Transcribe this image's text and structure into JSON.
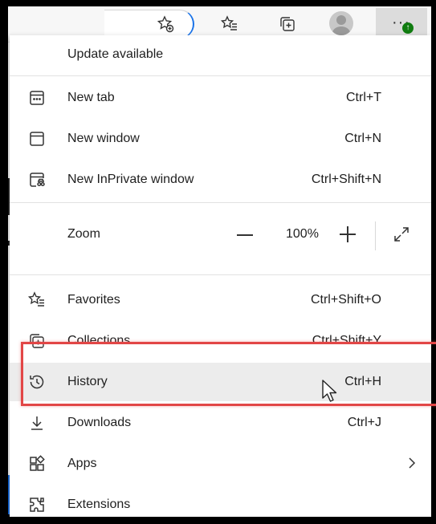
{
  "toolbar": {
    "icons": [
      "add-to-favorites-icon",
      "favorites-icon",
      "collections-icon",
      "profile-avatar",
      "more-options-icon"
    ],
    "colors": {
      "update_badge": "#107c10",
      "accent": "#1a73e8"
    }
  },
  "menu": {
    "update": {
      "label": "Update available"
    },
    "new_tab": {
      "label": "New tab",
      "shortcut": "Ctrl+T"
    },
    "new_window": {
      "label": "New window",
      "shortcut": "Ctrl+N"
    },
    "new_inprivate": {
      "label": "New InPrivate window",
      "shortcut": "Ctrl+Shift+N"
    },
    "zoom": {
      "label": "Zoom",
      "value": "100%"
    },
    "favorites": {
      "label": "Favorites",
      "shortcut": "Ctrl+Shift+O"
    },
    "collections": {
      "label": "Collections",
      "shortcut": "Ctrl+Shift+Y"
    },
    "history": {
      "label": "History",
      "shortcut": "Ctrl+H"
    },
    "downloads": {
      "label": "Downloads",
      "shortcut": "Ctrl+J"
    },
    "apps": {
      "label": "Apps"
    },
    "extensions": {
      "label": "Extensions"
    }
  },
  "annotation": {
    "highlight_color": "#e24646"
  }
}
